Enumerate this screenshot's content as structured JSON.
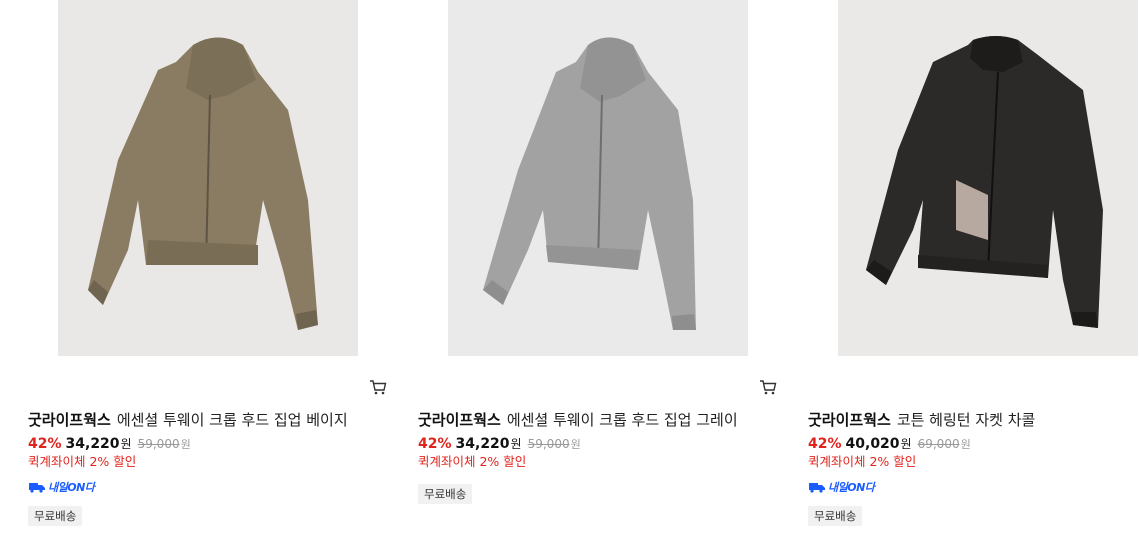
{
  "products": [
    {
      "brand": "굿라이프웍스",
      "name": "에센셜 투웨이 크롭 후드 집업 베이지",
      "discount": "42%",
      "price": "34,220",
      "price_unit": "원",
      "original_price": "59,000",
      "original_unit": "원",
      "promo": "퀵계좌이체 2% 할인",
      "tomorrow_badge": "내일ON다",
      "shipping": "무료배송",
      "jacket_color": "#8a7c62",
      "image": "olive hooded zip-up jacket"
    },
    {
      "brand": "굿라이프웍스",
      "name": "에센셜 투웨이 크롭 후드 집업 그레이",
      "discount": "42%",
      "price": "34,220",
      "price_unit": "원",
      "original_price": "59,000",
      "original_unit": "원",
      "promo": "퀵계좌이체 2% 할인",
      "tomorrow_badge": "",
      "shipping": "무료배송",
      "jacket_color": "#a2a2a2",
      "image": "grey hooded zip-up jacket"
    },
    {
      "brand": "굿라이프웍스",
      "name": "코튼 헤링턴 자켓 차콜",
      "discount": "42%",
      "price": "40,020",
      "price_unit": "원",
      "original_price": "69,000",
      "original_unit": "원",
      "promo": "퀵계좌이체 2% 할인",
      "tomorrow_badge": "내일ON다",
      "shipping": "무료배송",
      "jacket_color": "#2c2a28",
      "image": "charcoal harrington jacket"
    }
  ],
  "colors": {
    "discount": "#e0241c",
    "tomorrow": "#1a5cff",
    "ship_bg": "#f1f1f1"
  }
}
